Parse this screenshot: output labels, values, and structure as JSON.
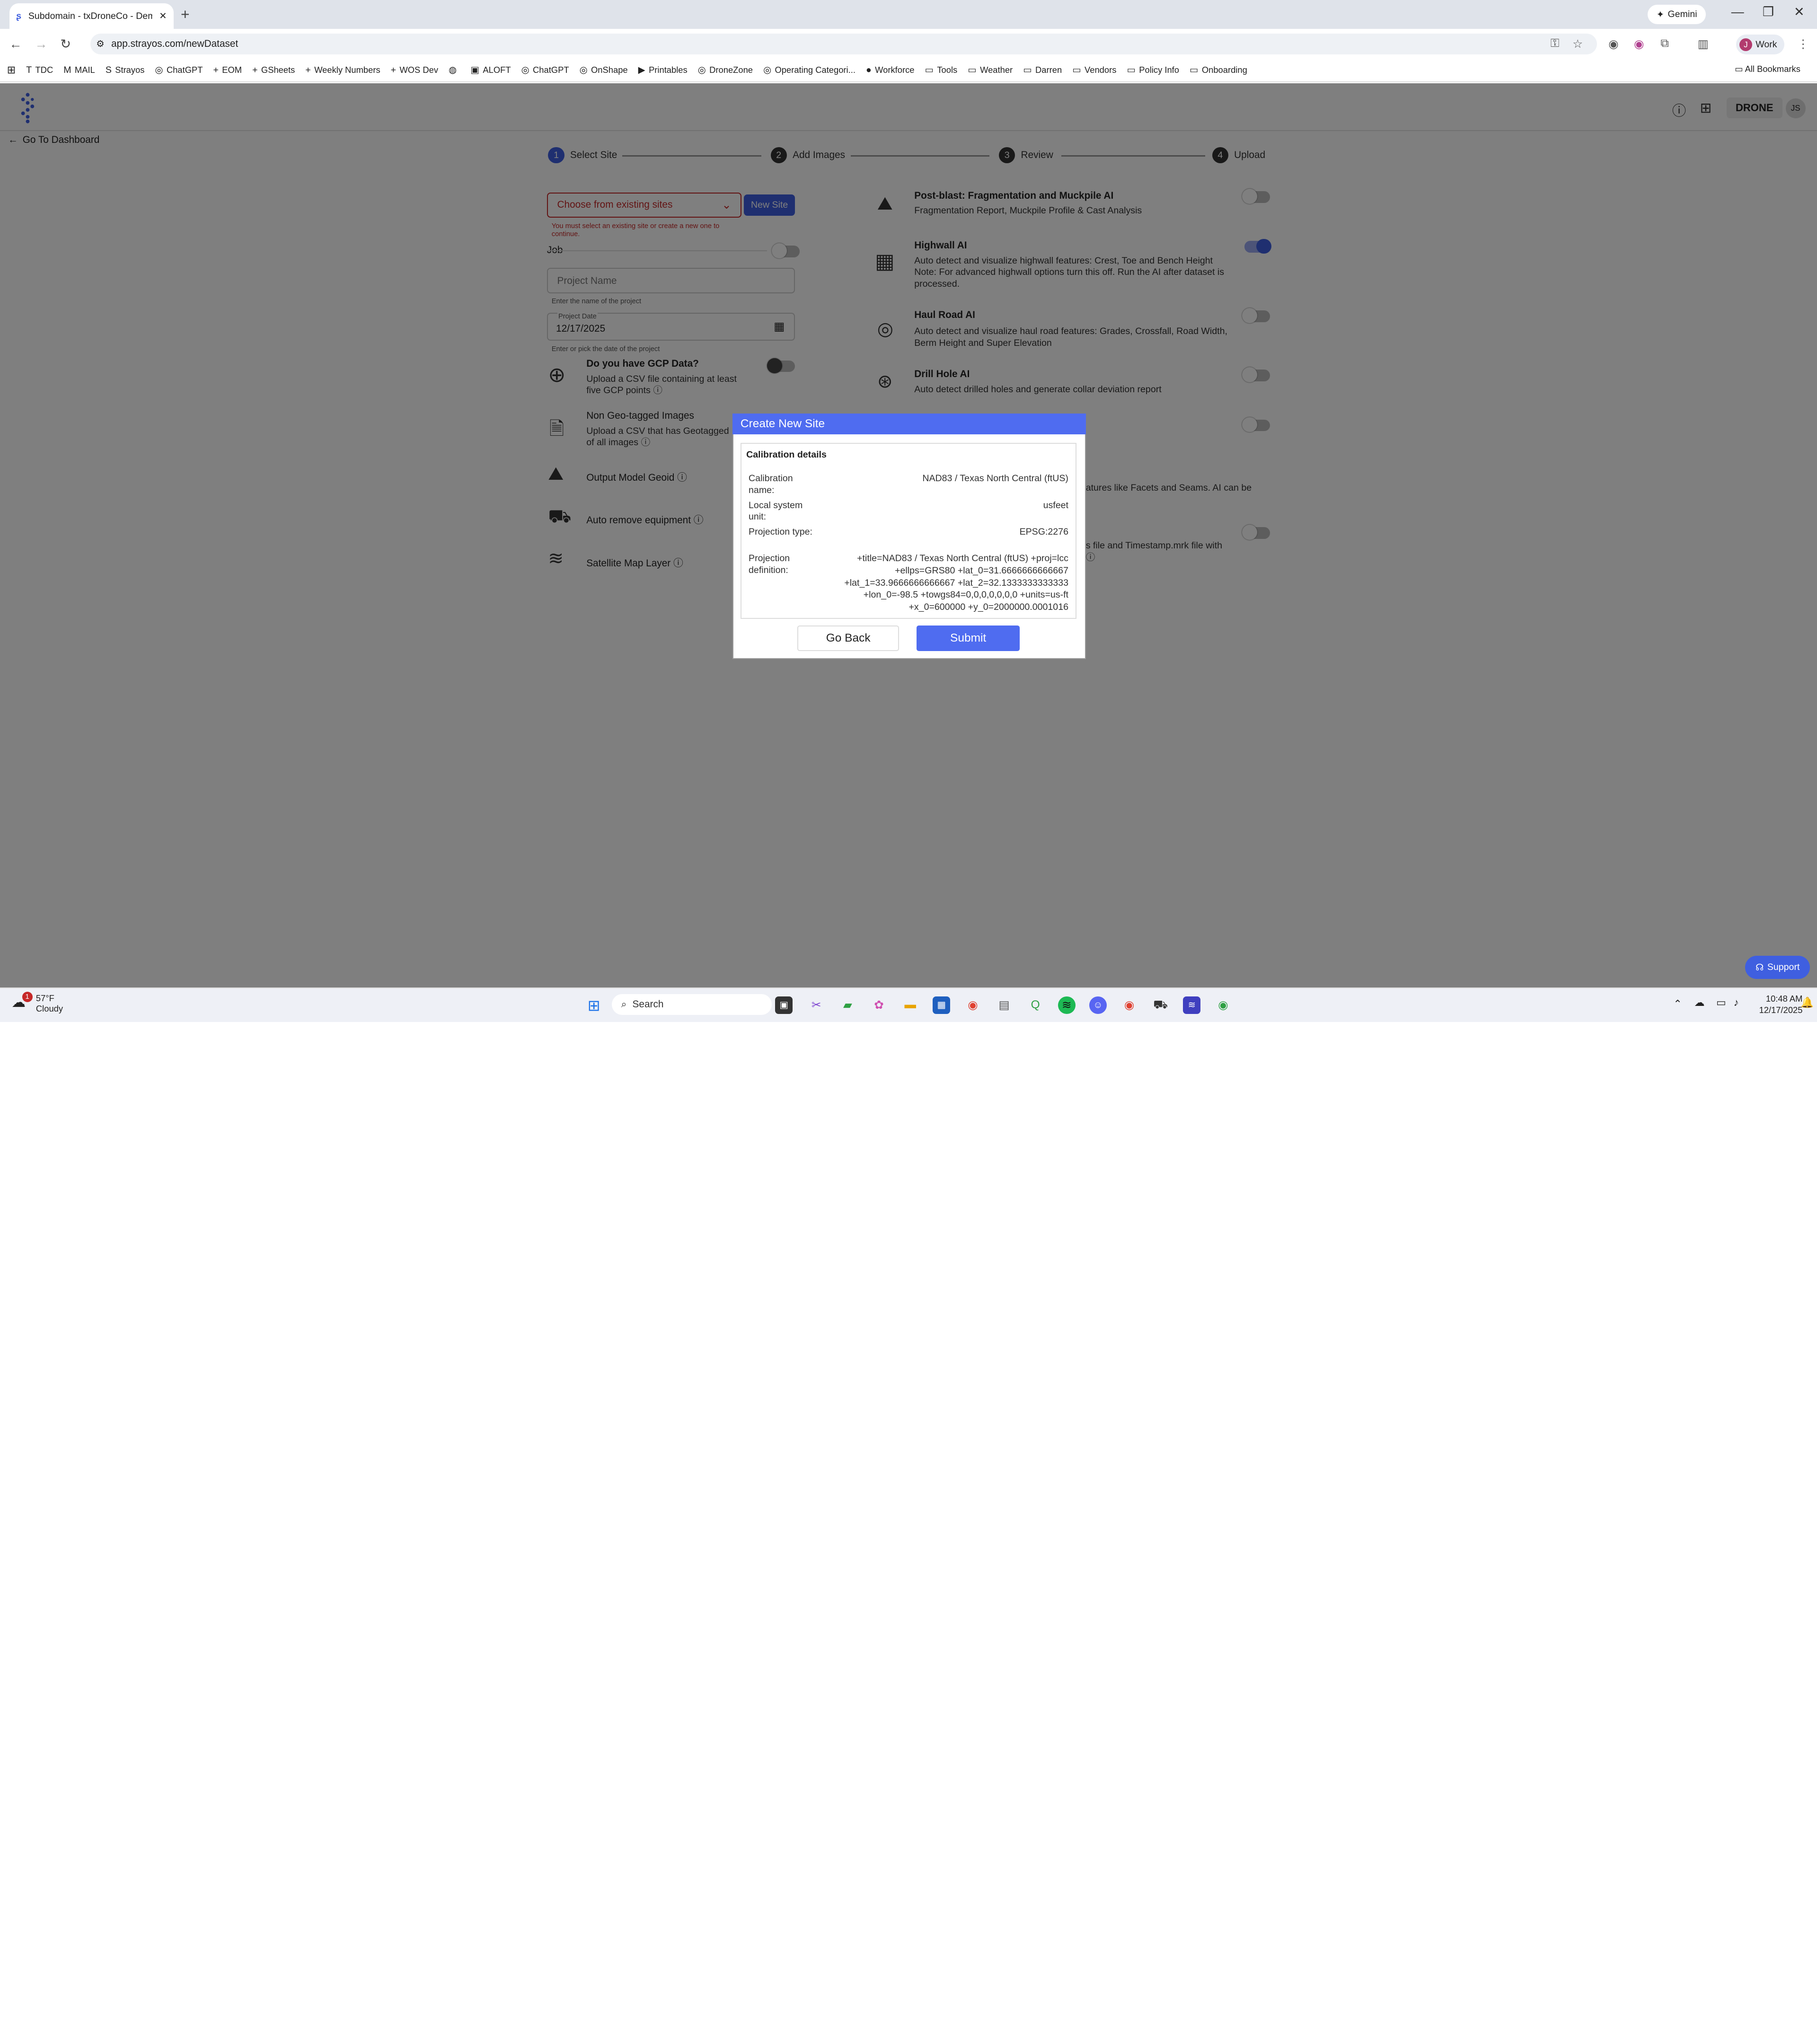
{
  "browser": {
    "tab_title": "Subdomain - txDroneCo - Dem",
    "url": "app.strayos.com/newDataset",
    "gemini_label": "Gemini",
    "profile_label": "Work",
    "profile_initial": "J",
    "all_bookmarks": "All Bookmarks",
    "bookmarks": [
      {
        "label": "TDC",
        "icon": "T"
      },
      {
        "label": "MAIL",
        "icon": "M"
      },
      {
        "label": "Strayos",
        "icon": "S"
      },
      {
        "label": "ChatGPT",
        "icon": "◎"
      },
      {
        "label": "EOM",
        "icon": "+"
      },
      {
        "label": "GSheets",
        "icon": "+"
      },
      {
        "label": "Weekly Numbers",
        "icon": "+"
      },
      {
        "label": "WOS Dev",
        "icon": "+"
      },
      {
        "label": "",
        "icon": "◍"
      },
      {
        "label": "ALOFT",
        "icon": "▣"
      },
      {
        "label": "ChatGPT",
        "icon": "◎"
      },
      {
        "label": "OnShape",
        "icon": "◎"
      },
      {
        "label": "Printables",
        "icon": "▶"
      },
      {
        "label": "DroneZone",
        "icon": "◎"
      },
      {
        "label": "Operating Categori...",
        "icon": "◎"
      },
      {
        "label": "Workforce",
        "icon": "●"
      },
      {
        "label": "Tools",
        "icon": "▭"
      },
      {
        "label": "Weather",
        "icon": "▭"
      },
      {
        "label": "Darren",
        "icon": "▭"
      },
      {
        "label": "Vendors",
        "icon": "▭"
      },
      {
        "label": "Policy Info",
        "icon": "▭"
      },
      {
        "label": "Onboarding",
        "icon": "▭"
      }
    ]
  },
  "app": {
    "back_label": "Go To Dashboard",
    "drone_badge": "DRONE",
    "user_initials": "JS",
    "steps": [
      {
        "num": "1",
        "label": "Select Site"
      },
      {
        "num": "2",
        "label": "Add Images"
      },
      {
        "num": "3",
        "label": "Review"
      },
      {
        "num": "4",
        "label": "Upload"
      }
    ],
    "site_select_placeholder": "Choose from existing sites",
    "new_site_label": "New Site",
    "site_error": "You must select an existing site or create a new one to continue.",
    "job_label": "Job",
    "project_name_placeholder": "Project Name",
    "project_name_hint": "Enter the name of the project",
    "project_date_label": "Project Date",
    "project_date_value": "12/17/2025",
    "project_date_hint": "Enter or pick the date of the project",
    "gcp_title": "Do you have GCP Data?",
    "gcp_desc": "Upload a CSV file containing at least five GCP points",
    "nongeo_title": "Non Geo-tagged Images",
    "nongeo_desc": "Upload a CSV that has Geotagged of all images",
    "output_model": "Output Model Geoid",
    "auto_remove": "Auto remove equipment",
    "satellite": "Satellite Map Layer",
    "features": [
      {
        "title": "Post-blast: Fragmentation and Muckpile AI",
        "desc": "Fragmentation Report, Muckpile Profile & Cast Analysis",
        "on": false
      },
      {
        "title": "Highwall AI",
        "desc": "Auto detect and visualize highwall features: Crest, Toe and Bench Height Note: For advanced highwall options turn this off. Run the AI after dataset is processed.",
        "on": true
      },
      {
        "title": "Haul Road AI",
        "desc": "Auto detect and visualize haul road features: Grades, Crossfall, Road Width, Berm Height and Super Elevation",
        "on": false
      },
      {
        "title": "Drill Hole AI",
        "desc": "Auto detect drilled holes and generate collar deviation report",
        "on": false
      }
    ],
    "partial_text_1": "atures like Facets and Seams. AI can be",
    "partial_text_2": "s file and Timestamp.mrk file with",
    "support_label": "Support"
  },
  "modal": {
    "title": "Create New Site",
    "section_title": "Calibration details",
    "rows": [
      {
        "label": "Calibration name:",
        "value": "NAD83 / Texas North Central (ftUS)"
      },
      {
        "label": "Local system unit:",
        "value": "usfeet"
      },
      {
        "label": "Projection type:",
        "value": "EPSG:2276"
      },
      {
        "label": "Projection definition:",
        "value": "+title=NAD83 / Texas North Central (ftUS) +proj=lcc +ellps=GRS80 +lat_0=31.6666666666667 +lat_1=33.9666666666667 +lat_2=32.1333333333333 +lon_0=-98.5 +towgs84=0,0,0,0,0,0,0 +units=us-ft +x_0=600000 +y_0=2000000.0001016"
      }
    ],
    "go_back_label": "Go Back",
    "submit_label": "Submit"
  },
  "taskbar": {
    "weather_temp": "57°F",
    "weather_cond": "Cloudy",
    "weather_badge": "1",
    "search_label": "Search",
    "time": "10:48 AM",
    "date": "12/17/2025"
  }
}
